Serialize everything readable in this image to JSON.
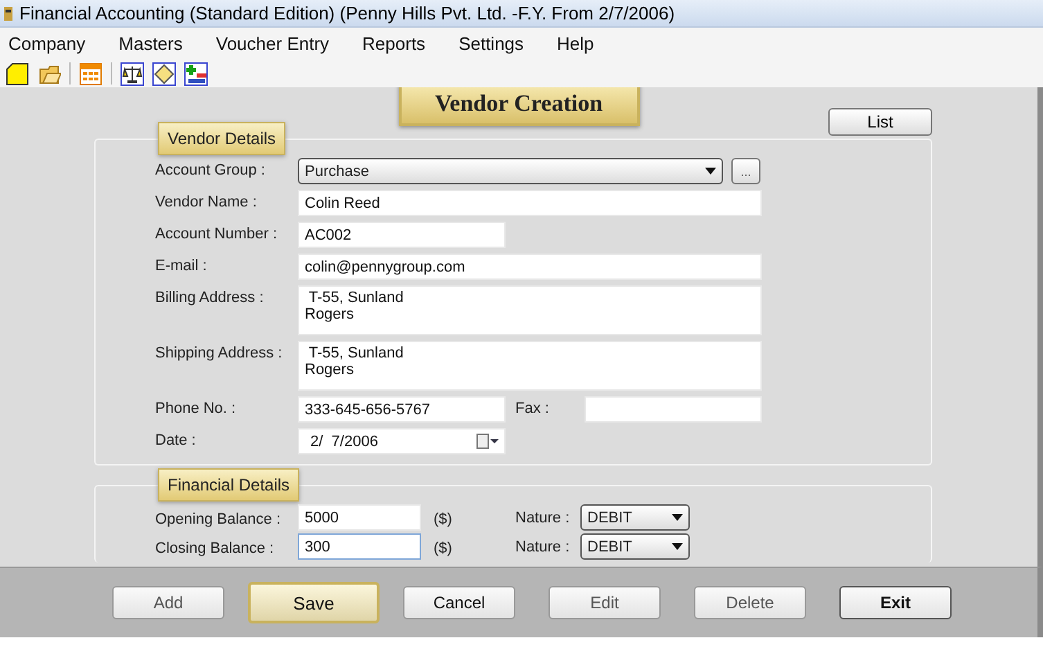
{
  "window": {
    "title": "Financial Accounting (Standard Edition) (Penny Hills Pvt. Ltd. -F.Y. From 2/7/2006)"
  },
  "menu": [
    {
      "label": "Company"
    },
    {
      "label": "Masters"
    },
    {
      "label": "Voucher Entry"
    },
    {
      "label": "Reports"
    },
    {
      "label": "Settings"
    },
    {
      "label": "Help"
    }
  ],
  "heading": "Vendor Creation",
  "list_button": "List",
  "vendor_details": {
    "legend": "Vendor Details",
    "fields": [
      {
        "kind": "dropdown",
        "label": "Account Group :",
        "value": "Purchase",
        "more_button": "..."
      },
      {
        "kind": "text",
        "label": "Vendor Name :",
        "value": "Colin Reed"
      },
      {
        "kind": "short_text",
        "label": "Account Number :",
        "value": "AC002"
      },
      {
        "kind": "text",
        "label": "E-mail :",
        "value": "colin@pennygroup.com"
      },
      {
        "kind": "multiline",
        "label": "Billing Address :",
        "value": " T-55, Sunland\nRogers"
      },
      {
        "kind": "multiline",
        "label": "Shipping Address :",
        "value": " T-55, Sunland\nRogers"
      },
      {
        "kind": "pair",
        "label": "Phone No. :",
        "value": "333-645-656-5767",
        "label_2": "Fax :"
      },
      {
        "kind": "date",
        "label": "Date :",
        "value": "2/  7/2006"
      }
    ]
  },
  "financial_details": {
    "legend": "Financial Details",
    "rows": [
      {
        "label": "Opening Balance :",
        "value": "5000",
        "unit": "($)",
        "nature_label": "Nature :",
        "nature": "DEBIT",
        "focused": false
      },
      {
        "label": "Closing Balance :",
        "value": "300",
        "unit": "($)",
        "nature_label": "Nature :",
        "nature": "DEBIT",
        "focused": true
      }
    ]
  },
  "buttons": [
    {
      "label": "Add",
      "disabled": true,
      "highlighted": false
    },
    {
      "label": "Save",
      "disabled": false,
      "highlighted": true
    },
    {
      "label": "Cancel",
      "disabled": false,
      "highlighted": false
    },
    {
      "label": "Edit",
      "disabled": true,
      "highlighted": false
    },
    {
      "label": "Delete",
      "disabled": true,
      "highlighted": false
    },
    {
      "label": "Exit",
      "disabled": false,
      "highlighted": false
    }
  ]
}
